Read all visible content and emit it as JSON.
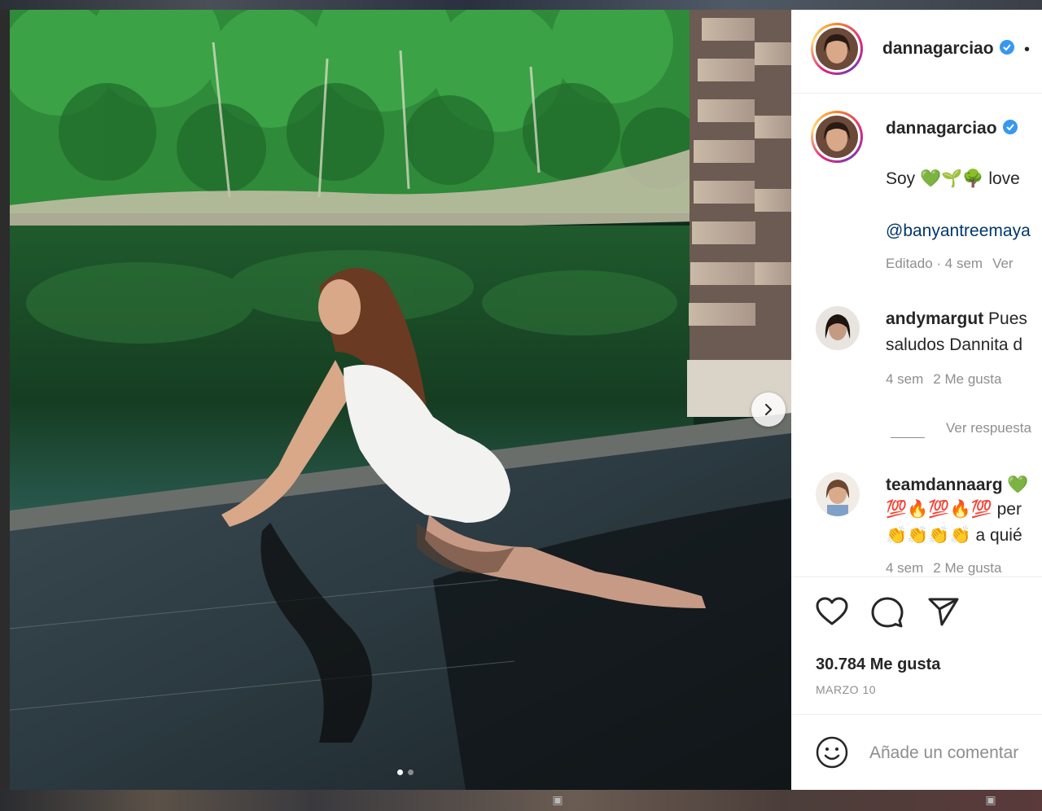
{
  "post": {
    "username": "dannagarciao",
    "header_more": "•",
    "caption": {
      "prefix": "Soy",
      "emojis": "💚🌱🌳",
      "suffix": "love",
      "mention": "@banyantreemaya",
      "edited": "Editado · 4 sem",
      "translate": "Ver"
    },
    "comments": [
      {
        "user": "andymargut",
        "text_line1": "Pues",
        "text_line2": "saludos Dannita d",
        "age": "4 sem",
        "likes": "2 Me gusta",
        "view_replies": "Ver respuesta"
      },
      {
        "user": "teamdannaarg",
        "emoji_after_user": "💚",
        "line2_emojis": "💯🔥💯🔥💯",
        "line2_text": "per",
        "line3_emojis": "👏👏👏👏",
        "line3_text": "a quié",
        "age": "4 sem",
        "likes": "2 Me gusta"
      }
    ],
    "likes_count": "30.784 Me gusta",
    "date": "MARZO 10",
    "add_comment_placeholder": "Añade un comentar",
    "carousel": {
      "total": 2,
      "active": 1
    }
  },
  "colors": {
    "verified": "#3897f0",
    "mention": "#00376b",
    "text": "#262626",
    "muted": "#8e8e8e",
    "divider": "#efefef"
  },
  "icons": [
    "chevron-right-icon",
    "heart-icon",
    "comment-icon",
    "share-icon",
    "emoji-icon",
    "verified-badge-icon",
    "reel-icon"
  ]
}
